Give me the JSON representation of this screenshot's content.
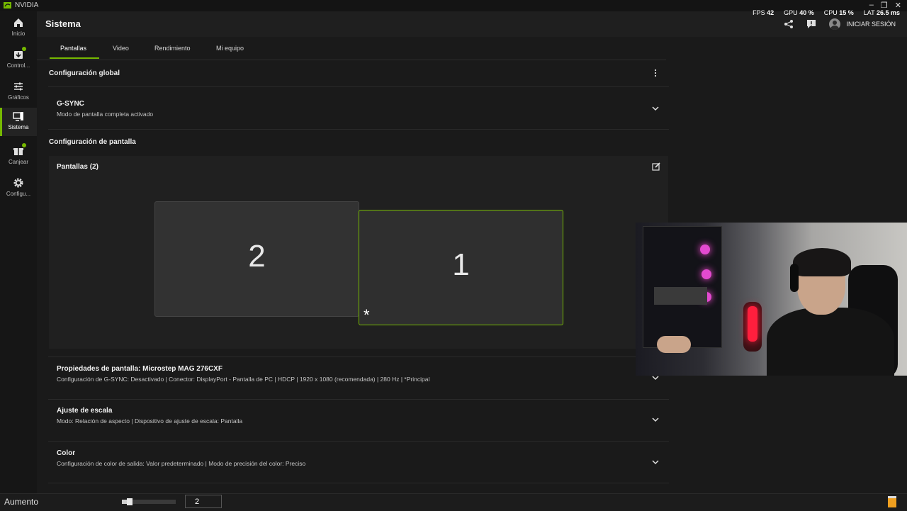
{
  "window": {
    "app_name": "NVIDIA",
    "minimize": "–",
    "restore": "❐",
    "close": "✕"
  },
  "stats": {
    "fps_label": "FPS",
    "fps_value": "42",
    "gpu_label": "GPU",
    "gpu_value": "40 %",
    "cpu_label": "CPU",
    "cpu_value": "15 %",
    "lat_label": "LAT",
    "lat_value": "26.5 ms"
  },
  "sidebar": {
    "items": [
      {
        "label": "Inicio",
        "icon": "home-icon"
      },
      {
        "label": "Control...",
        "icon": "download-icon"
      },
      {
        "label": "Gráficos",
        "icon": "sliders-icon"
      },
      {
        "label": "Sistema",
        "icon": "system-icon"
      },
      {
        "label": "Canjear",
        "icon": "gift-icon"
      },
      {
        "label": "Configu...",
        "icon": "gear-icon"
      }
    ],
    "active_index": 3,
    "accent": "#76b900"
  },
  "header": {
    "title": "Sistema",
    "login": "INICIAR SESIÓN"
  },
  "tabs": [
    "Pantallas",
    "Video",
    "Rendimiento",
    "Mi equipo"
  ],
  "global": {
    "title": "Configuración global",
    "gsync_title": "G-SYNC",
    "gsync_sub": "Modo de pantalla completa activado"
  },
  "display_config": {
    "title": "Configuración de pantalla",
    "panel_title": "Pantallas (2)",
    "monitor_left": "2",
    "monitor_right": "1",
    "primary_marker": "*"
  },
  "rows": [
    {
      "title": "Propiedades de pantalla: Microstep MAG 276CXF",
      "sub": "Configuración de G-SYNC: Desactivado | Conector: DisplayPort - Pantalla de PC | HDCP | 1920 x 1080 (recomendada) | 280 Hz | *Principal"
    },
    {
      "title": "Ajuste de escala",
      "sub": "Modo: Relación de aspecto | Dispositivo de ajuste de escala: Pantalla"
    },
    {
      "title": "Color",
      "sub": "Configuración de color de salida: Valor predeterminado | Modo de precisión del color: Preciso"
    }
  ],
  "bottombar": {
    "label": "Aumento",
    "value": "2",
    "slider_fraction": 0.1
  }
}
